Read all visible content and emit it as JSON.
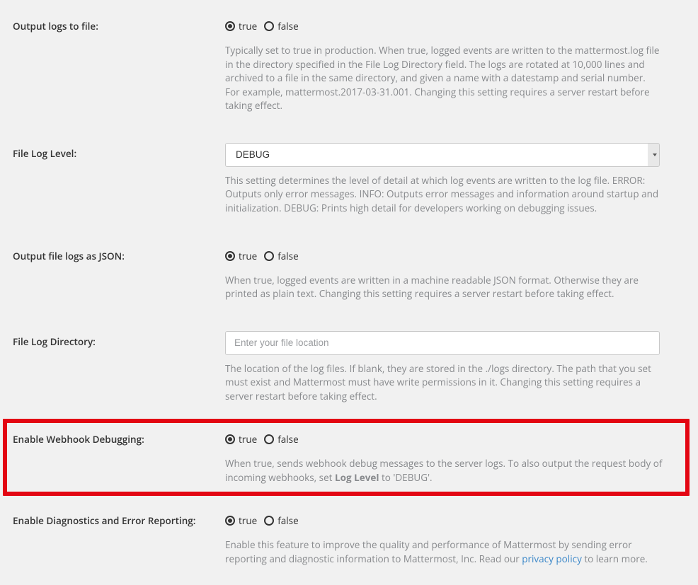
{
  "common": {
    "option_true": "true",
    "option_false": "false"
  },
  "fields": {
    "output_logs_file": {
      "label": "Output logs to file:",
      "value": "true",
      "help": "Typically set to true in production. When true, logged events are written to the mattermost.log file in the directory specified in the File Log Directory field. The logs are rotated at 10,000 lines and archived to a file in the same directory, and given a name with a datestamp and serial number. For example, mattermost.2017-03-31.001. Changing this setting requires a server restart before taking effect."
    },
    "file_log_level": {
      "label": "File Log Level:",
      "value": "DEBUG",
      "help": "This setting determines the level of detail at which log events are written to the log file. ERROR: Outputs only error messages. INFO: Outputs error messages and information around startup and initialization. DEBUG: Prints high detail for developers working on debugging issues."
    },
    "output_json": {
      "label": "Output file logs as JSON:",
      "value": "true",
      "help": "When true, logged events are written in a machine readable JSON format. Otherwise they are printed as plain text. Changing this setting requires a server restart before taking effect."
    },
    "file_log_dir": {
      "label": "File Log Directory:",
      "placeholder": "Enter your file location",
      "help": "The location of the log files. If blank, they are stored in the ./logs directory. The path that you set must exist and Mattermost must have write permissions in it. Changing this setting requires a server restart before taking effect."
    },
    "webhook_debug": {
      "label": "Enable Webhook Debugging:",
      "value": "true",
      "help_pre": "When true, sends webhook debug messages to the server logs. To also output the request body of incoming webhooks, set ",
      "help_bold": "Log Level",
      "help_post": " to 'DEBUG'."
    },
    "diagnostics": {
      "label": "Enable Diagnostics and Error Reporting:",
      "value": "true",
      "help_pre": "Enable this feature to improve the quality and performance of Mattermost by sending error reporting and diagnostic information to Mattermost, Inc. Read our ",
      "help_link": "privacy policy",
      "help_post": " to learn more."
    }
  }
}
